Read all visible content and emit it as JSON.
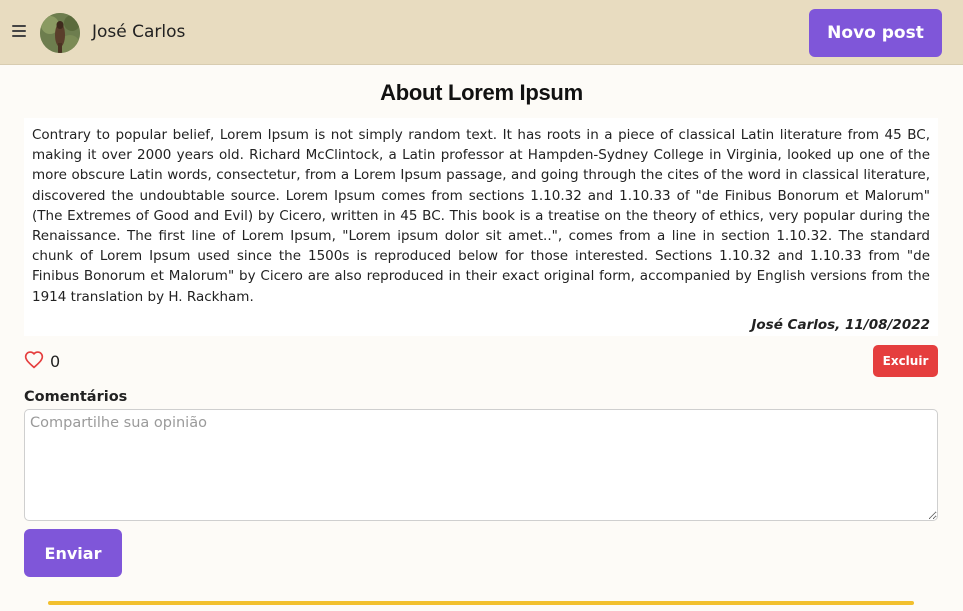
{
  "header": {
    "user_name": "José Carlos",
    "new_post_label": "Novo post"
  },
  "post": {
    "title": "About Lorem Ipsum",
    "body": "Contrary to popular belief, Lorem Ipsum is not simply random text. It has roots in a piece of classical Latin literature from 45 BC, making it over 2000 years old. Richard McClintock, a Latin professor at Hampden-Sydney College in Virginia, looked up one of the more obscure Latin words, consectetur, from a Lorem Ipsum passage, and going through the cites of the word in classical literature, discovered the undoubtable source. Lorem Ipsum comes from sections 1.10.32 and 1.10.33 of \"de Finibus Bonorum et Malorum\" (The Extremes of Good and Evil) by Cicero, written in 45 BC. This book is a treatise on the theory of ethics, very popular during the Renaissance. The first line of Lorem Ipsum, \"Lorem ipsum dolor sit amet..\", comes from a line in section 1.10.32. The standard chunk of Lorem Ipsum used since the 1500s is reproduced below for those interested. Sections 1.10.32 and 1.10.33 from \"de Finibus Bonorum et Malorum\" by Cicero are also reproduced in their exact original form, accompanied by English versions from the 1914 translation by H. Rackham.",
    "meta": "José Carlos, 11/08/2022",
    "likes": "0",
    "delete_label": "Excluir"
  },
  "comments": {
    "label": "Comentários",
    "placeholder": "Compartilhe sua opinião",
    "value": "",
    "submit_label": "Enviar"
  },
  "icons": {
    "menu": "hamburger-menu-icon",
    "like": "heart-outline-icon"
  },
  "colors": {
    "header_bg": "#e8dcc0",
    "primary": "#7f56d9",
    "danger": "#e53e3e",
    "heart": "#e53e3e",
    "divider": "#f2c02e",
    "page_bg": "#fdfbf7"
  }
}
